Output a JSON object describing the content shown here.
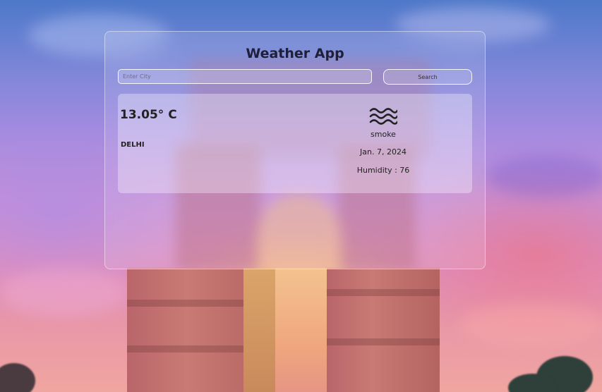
{
  "app": {
    "title": "Weather App"
  },
  "search": {
    "placeholder": "Enter City",
    "value": "",
    "button_label": "Search"
  },
  "weather": {
    "temperature": "13.05° C",
    "city": "DELHI",
    "icon": "smoke-icon",
    "description": "smoke",
    "date": "Jan. 7, 2024",
    "humidity": "Humidity : 76"
  },
  "colors": {
    "text": "#222222",
    "title": "#1f1f3a"
  }
}
